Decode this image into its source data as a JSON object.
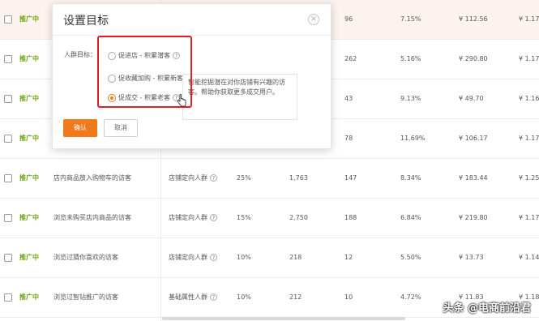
{
  "rows": [
    {
      "status": "推广中",
      "name": "",
      "crowd": "",
      "pct": "",
      "num": "",
      "col5": "96",
      "rate": "7.15%",
      "price": "¥ 112.56",
      "more": "¥ 1.17"
    },
    {
      "status": "推广中",
      "name": "",
      "crowd": "",
      "pct": "",
      "num": "",
      "col5": "262",
      "rate": "5.16%",
      "price": "¥ 290.80",
      "more": "¥ 1.17"
    },
    {
      "status": "推广中",
      "name": "",
      "crowd": "",
      "pct": "",
      "num": "",
      "col5": "43",
      "rate": "9.13%",
      "price": "¥ 49.70",
      "more": "¥ 1.16"
    },
    {
      "status": "推广中",
      "name": "",
      "crowd": "",
      "pct": "",
      "num": "",
      "col5": "78",
      "rate": "11.69%",
      "price": "¥ 106.17",
      "more": "¥ 1.17"
    },
    {
      "status": "推广中",
      "name": "店内商品放入购物车的访客",
      "crowd": "店铺定向人群",
      "pct": "25%",
      "num": "1,763",
      "col5": "147",
      "rate": "8.34%",
      "price": "¥ 183.44",
      "more": "¥ 1.25"
    },
    {
      "status": "推广中",
      "name": "浏览未购买店内商品的访客",
      "crowd": "店铺定向人群",
      "pct": "15%",
      "num": "2,750",
      "col5": "188",
      "rate": "6.84%",
      "price": "¥ 219.80",
      "more": "¥ 1.17"
    },
    {
      "status": "推广中",
      "name": "浏览过猜你喜欢的访客",
      "crowd": "店铺定向人群",
      "pct": "10%",
      "num": "218",
      "col5": "12",
      "rate": "5.50%",
      "price": "¥ 13.73",
      "more": "¥ 1.14"
    },
    {
      "status": "推广中",
      "name": "浏览过智钻推广的访客",
      "crowd": "基础属性人群",
      "pct": "10%",
      "num": "212",
      "col5": "10",
      "rate": "4.72%",
      "price": "¥ 11.83",
      "more": "¥ 1.18"
    }
  ],
  "dialog": {
    "title": "设置目标",
    "close": "×",
    "field_label": "人群目标：",
    "options": [
      "促进店 - 积累潜客",
      "促收藏加购 - 积累新客",
      "促成交 - 积累老客"
    ],
    "selected_index": 2,
    "help": "?",
    "tip_text": "智能挖掘潜在对你店铺有兴趣的访客。帮助你获取更多成交用户。",
    "confirm": "确认",
    "cancel": "取消"
  },
  "watermark": "头条 @电商前沿君",
  "colors": {
    "accent": "#f07a1a",
    "status_green": "#6aa50f",
    "highlight": "#e02020"
  }
}
